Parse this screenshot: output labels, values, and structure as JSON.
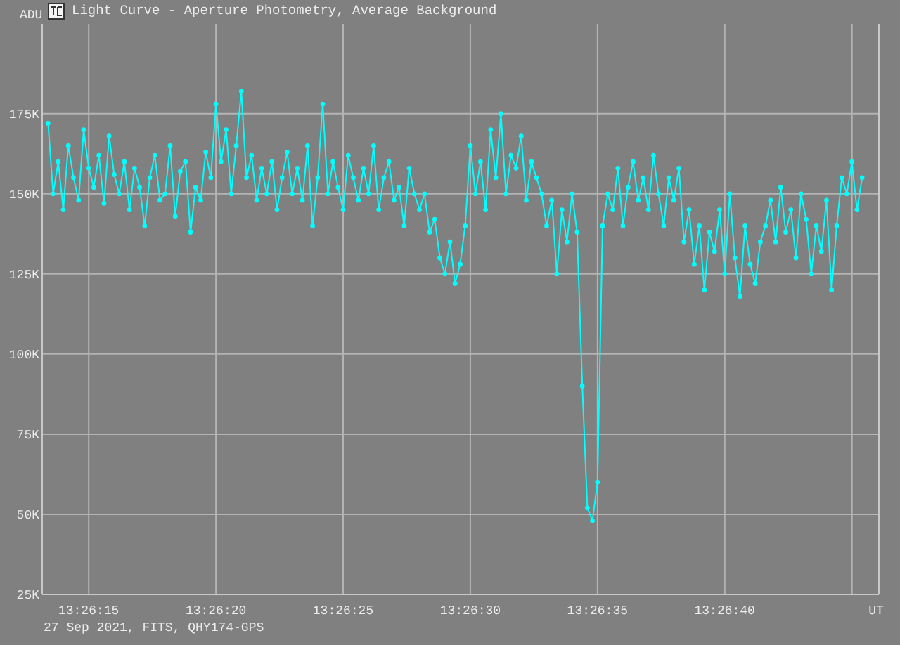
{
  "window": {
    "title": "Light Curve - Aperture Photometry, Average Background"
  },
  "plot": {
    "chart_data": {
      "type": "line",
      "grid": true,
      "ylabel": "ADU",
      "xlabel": "UT",
      "xlim": [
        48373.17,
        48406.06
      ],
      "ylim": [
        25000,
        203000
      ],
      "xticks": [
        {
          "value": 48375,
          "label": "13:26:15"
        },
        {
          "value": 48380,
          "label": "13:26:20"
        },
        {
          "value": 48385,
          "label": "13:26:25"
        },
        {
          "value": 48390,
          "label": "13:26:30"
        },
        {
          "value": 48395,
          "label": "13:26:35"
        },
        {
          "value": 48400,
          "label": "13:26:40"
        }
      ],
      "yticks": [
        {
          "value": 25000,
          "label": "25K"
        },
        {
          "value": 50000,
          "label": "50K"
        },
        {
          "value": 75000,
          "label": "75K"
        },
        {
          "value": 100000,
          "label": "100K"
        },
        {
          "value": 125000,
          "label": "125K"
        },
        {
          "value": 150000,
          "label": "150K"
        },
        {
          "value": 175000,
          "label": "175K"
        }
      ],
      "x": [
        48373.4,
        48373.6,
        48373.8,
        48374.0,
        48374.2,
        48374.4,
        48374.6,
        48374.8,
        48375.0,
        48375.2,
        48375.4,
        48375.6,
        48375.8,
        48376.0,
        48376.2,
        48376.4,
        48376.6,
        48376.8,
        48377.0,
        48377.2,
        48377.4,
        48377.6,
        48377.8,
        48378.0,
        48378.2,
        48378.4,
        48378.6,
        48378.8,
        48379.0,
        48379.2,
        48379.4,
        48379.6,
        48379.8,
        48380.0,
        48380.2,
        48380.4,
        48380.6,
        48380.8,
        48381.0,
        48381.2,
        48381.4,
        48381.6,
        48381.8,
        48382.0,
        48382.2,
        48382.4,
        48382.6,
        48382.8,
        48383.0,
        48383.2,
        48383.4,
        48383.6,
        48383.8,
        48384.0,
        48384.2,
        48384.4,
        48384.6,
        48384.8,
        48385.0,
        48385.2,
        48385.4,
        48385.6,
        48385.8,
        48386.0,
        48386.2,
        48386.4,
        48386.6,
        48386.8,
        48387.0,
        48387.2,
        48387.4,
        48387.6,
        48387.8,
        48388.0,
        48388.2,
        48388.4,
        48388.6,
        48388.8,
        48389.0,
        48389.2,
        48389.4,
        48389.6,
        48389.8,
        48390.0,
        48390.2,
        48390.4,
        48390.6,
        48390.8,
        48391.0,
        48391.2,
        48391.4,
        48391.6,
        48391.8,
        48392.0,
        48392.2,
        48392.4,
        48392.6,
        48392.8,
        48393.0,
        48393.2,
        48393.4,
        48393.6,
        48393.8,
        48394.0,
        48394.2,
        48394.4,
        48394.6,
        48394.8,
        48395.0,
        48395.2,
        48395.4,
        48395.6,
        48395.8,
        48396.0,
        48396.2,
        48396.4,
        48396.6,
        48396.8,
        48397.0,
        48397.2,
        48397.4,
        48397.6,
        48397.8,
        48398.0,
        48398.2,
        48398.4,
        48398.6,
        48398.8,
        48399.0,
        48399.2,
        48399.4,
        48399.6,
        48399.8,
        48400.0,
        48400.2,
        48400.4,
        48400.6,
        48400.8,
        48401.0,
        48401.2,
        48401.4,
        48401.6,
        48401.8,
        48402.0,
        48402.2,
        48402.4,
        48402.6,
        48402.8,
        48403.0,
        48403.2,
        48403.4,
        48403.6,
        48403.8,
        48404.0,
        48404.2,
        48404.4,
        48404.6,
        48404.8,
        48405.0,
        48405.2,
        48405.4
      ],
      "series": [
        {
          "color": "#00ffff",
          "marker": "circle",
          "values": [
            172000,
            150000,
            160000,
            145000,
            165000,
            155000,
            148000,
            170000,
            158000,
            152000,
            162000,
            147000,
            168000,
            156000,
            150000,
            160000,
            145000,
            158000,
            152000,
            140000,
            155000,
            162000,
            148000,
            150000,
            165000,
            143000,
            157000,
            160000,
            138000,
            152000,
            148000,
            163000,
            155000,
            178000,
            160000,
            170000,
            150000,
            165000,
            182000,
            155000,
            162000,
            148000,
            158000,
            150000,
            160000,
            145000,
            155000,
            163000,
            150000,
            158000,
            148000,
            165000,
            140000,
            155000,
            178000,
            150000,
            160000,
            152000,
            145000,
            162000,
            155000,
            148000,
            158000,
            150000,
            165000,
            145000,
            155000,
            160000,
            148000,
            152000,
            140000,
            158000,
            150000,
            145000,
            150000,
            138000,
            142000,
            130000,
            125000,
            135000,
            122000,
            128000,
            140000,
            165000,
            150000,
            160000,
            145000,
            170000,
            155000,
            175000,
            150000,
            162000,
            158000,
            168000,
            148000,
            160000,
            155000,
            150000,
            140000,
            148000,
            125000,
            145000,
            135000,
            150000,
            138000,
            90000,
            52000,
            48000,
            60000,
            140000,
            150000,
            145000,
            158000,
            140000,
            152000,
            160000,
            148000,
            155000,
            145000,
            162000,
            150000,
            140000,
            155000,
            148000,
            158000,
            135000,
            145000,
            128000,
            140000,
            120000,
            138000,
            132000,
            145000,
            125000,
            150000,
            130000,
            118000,
            140000,
            128000,
            122000,
            135000,
            140000,
            148000,
            135000,
            152000,
            138000,
            145000,
            130000,
            150000,
            142000,
            125000,
            140000,
            132000,
            148000,
            120000,
            140000,
            155000,
            150000,
            160000,
            145000,
            155000
          ]
        }
      ]
    }
  },
  "status_bar": {
    "text": "27 Sep 2021, FITS, QHY174-GPS"
  }
}
